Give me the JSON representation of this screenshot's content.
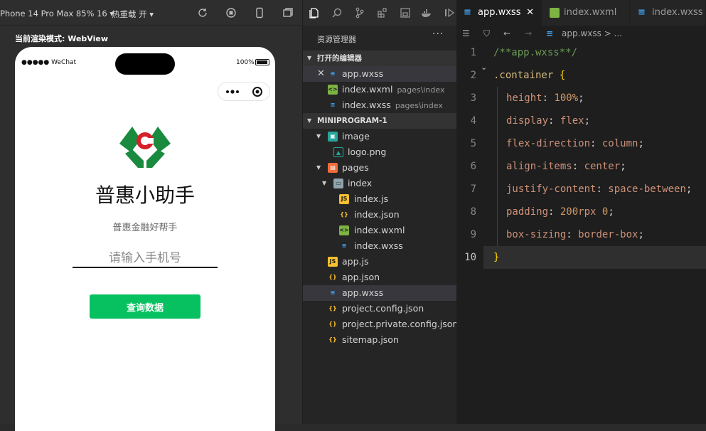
{
  "simulator": {
    "device": "Phone 14 Pro Max 85% 16 ▾",
    "hot_reload": "热重载 开 ▾",
    "render_mode": "当前渲染模式: WebView",
    "status_left": "●●●●● WeChat",
    "status_right": "100%",
    "app_title": "普惠小助手",
    "app_subtitle": "普惠金融好帮手",
    "phone_placeholder": "请输入手机号",
    "query_button": "查询数据",
    "brand_green": "#1a8a3e",
    "button_green": "#07c160"
  },
  "explorer": {
    "title": "资源管理器",
    "more": "···",
    "open_editors": {
      "label": "打开的编辑器",
      "files": [
        {
          "name": "app.wxss",
          "path": "",
          "icon": "css-icon"
        },
        {
          "name": "index.wxml",
          "path": "pages\\index",
          "icon": "wxml-icon"
        },
        {
          "name": "index.wxss",
          "path": "pages\\index",
          "icon": "css-icon"
        }
      ]
    },
    "project": {
      "label": "MINIPROGRAM-1",
      "items": [
        {
          "name": "image",
          "icon": "folder-image-icon"
        },
        {
          "name": "logo.png",
          "icon": "image-file-icon"
        },
        {
          "name": "pages",
          "icon": "folder-pages-icon"
        },
        {
          "name": "index",
          "icon": "folder-open-icon"
        },
        {
          "name": "index.js",
          "icon": "js-icon"
        },
        {
          "name": "index.json",
          "icon": "json-icon"
        },
        {
          "name": "index.wxml",
          "icon": "wxml-icon"
        },
        {
          "name": "index.wxss",
          "icon": "css-icon"
        },
        {
          "name": "app.js",
          "icon": "js-icon"
        },
        {
          "name": "app.json",
          "icon": "json-icon"
        },
        {
          "name": "app.wxss",
          "icon": "css-icon"
        },
        {
          "name": "project.config.json",
          "icon": "json-icon"
        },
        {
          "name": "project.private.config.json",
          "icon": "json-icon"
        },
        {
          "name": "sitemap.json",
          "icon": "json-icon"
        }
      ]
    }
  },
  "editor": {
    "tabs": [
      {
        "name": "app.wxss",
        "close": "✕"
      },
      {
        "name": "index.wxml"
      },
      {
        "name": "index.wxss"
      }
    ],
    "breadcrumb": "app.wxss > ...",
    "line_numbers": [
      "1",
      "2",
      "3",
      "4",
      "5",
      "6",
      "7",
      "8",
      "9",
      "10"
    ],
    "code": {
      "l1": "/**app.wxss**/",
      "l2_sel": ".container",
      "l2_br": " {",
      "l3_p": "height",
      "l3_v": "100%",
      "l4_p": "display",
      "l4_v": "flex",
      "l5_p": "flex-direction",
      "l5_v": "column",
      "l6_p": "align-items",
      "l6_v": "center",
      "l7_p": "justify-content",
      "l7_v": "space-between",
      "l8_p": "padding",
      "l8_v1": "200",
      "l8_u": "rpx",
      "l8_v2": "0",
      "l9_p": "box-sizing",
      "l9_v": "border-box",
      "l10": "}"
    }
  }
}
